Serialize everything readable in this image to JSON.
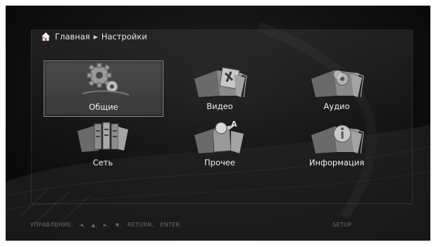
{
  "breadcrumb": {
    "home_label": "Главная",
    "current_label": "Настройки"
  },
  "menu": [
    {
      "id": "general",
      "label": "Общие",
      "icon": "gear-icon",
      "selected": true
    },
    {
      "id": "video",
      "label": "Видео",
      "icon": "video-folder-icon",
      "selected": false
    },
    {
      "id": "audio",
      "label": "Аудио",
      "icon": "audio-folder-icon",
      "selected": false
    },
    {
      "id": "network",
      "label": "Сеть",
      "icon": "network-folder-icon",
      "selected": false
    },
    {
      "id": "misc",
      "label": "Прочее",
      "icon": "misc-box-icon",
      "selected": false
    },
    {
      "id": "info",
      "label": "Информация",
      "icon": "info-folder-icon",
      "selected": false
    }
  ],
  "footer": {
    "controls_label": "УПРАВЛЕНИЕ:",
    "keys": [
      "◄,",
      "▲,",
      "►,",
      "▼,",
      "RETURN,",
      "ENTER"
    ],
    "mode_label": "SETUP"
  },
  "colors": {
    "background": "#121212",
    "text": "#f0f0f0",
    "footer_text": "#6c6c6c",
    "selection": "#3a3a3a"
  }
}
